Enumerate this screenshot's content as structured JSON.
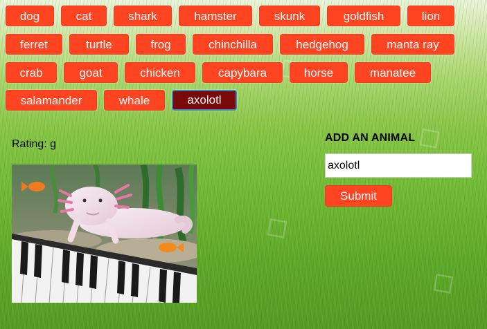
{
  "animals": [
    "dog",
    "cat",
    "shark",
    "hamster",
    "skunk",
    "goldfish",
    "lion",
    "ferret",
    "turtle",
    "frog",
    "chinchilla",
    "hedgehog",
    "manta ray",
    "crab",
    "goat",
    "chicken",
    "capybara",
    "horse",
    "manatee",
    "salamander",
    "whale",
    "axolotl"
  ],
  "selected_animal": "axolotl",
  "rating": {
    "text": "Rating: g"
  },
  "gif": {
    "subject": "axolotl playing a keyboard in an aquarium"
  },
  "add_form": {
    "heading": "ADD AN ANIMAL",
    "input_value": "axolotl",
    "submit_label": "Submit"
  },
  "colors": {
    "button": "#ff4422",
    "button_selected": "#7a0a0a",
    "selected_border": "#3a82b8",
    "background": "#6fb833"
  }
}
